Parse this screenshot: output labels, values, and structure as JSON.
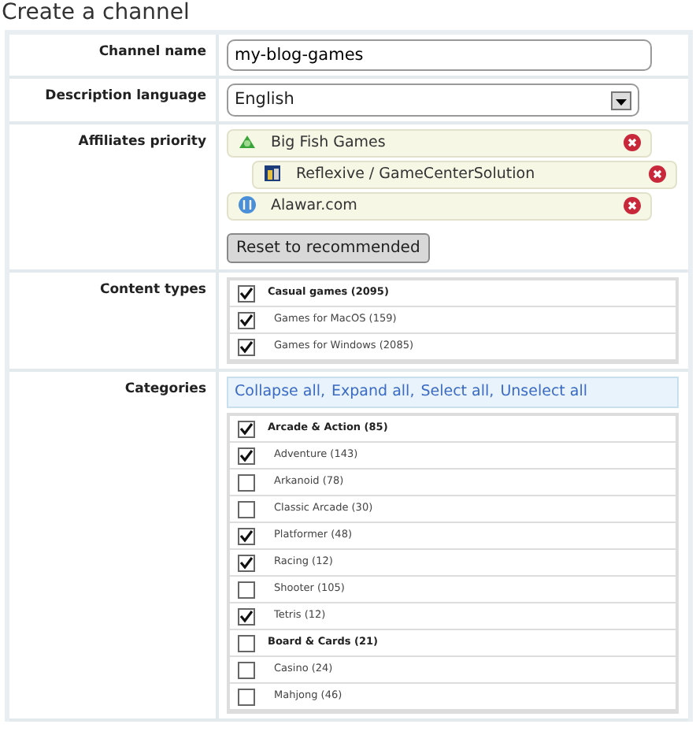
{
  "title": "Create a channel",
  "fields": {
    "channel_name": {
      "label": "Channel name",
      "value": "my-blog-games"
    },
    "language": {
      "label": "Description language",
      "value": "English"
    }
  },
  "affiliates": {
    "label": "Affiliates priority",
    "items": [
      {
        "name": "Big Fish Games",
        "children": [
          {
            "name": "Reflexive / GameCenterSolution"
          }
        ]
      },
      {
        "name": "Alawar.com"
      }
    ],
    "reset_button": "Reset to recommended"
  },
  "content_types": {
    "label": "Content types",
    "items": [
      {
        "name": "Casual games (2095)",
        "checked": true,
        "children": [
          {
            "name": "Games for MacOS (159)",
            "checked": true
          },
          {
            "name": "Games for Windows (2085)",
            "checked": true
          }
        ]
      }
    ]
  },
  "categories": {
    "label": "Categories",
    "link_separator": ",",
    "links": [
      "Collapse all",
      "Expand all",
      "Select all",
      "Unselect all"
    ],
    "items": [
      {
        "name": "Arcade & Action (85)",
        "checked": true,
        "children": [
          {
            "name": "Adventure (143)",
            "checked": true
          },
          {
            "name": "Arkanoid (78)",
            "checked": false
          },
          {
            "name": "Classic Arcade (30)",
            "checked": false
          },
          {
            "name": "Platformer (48)",
            "checked": true
          },
          {
            "name": "Racing (12)",
            "checked": true
          },
          {
            "name": "Shooter (105)",
            "checked": false
          },
          {
            "name": "Tetris (12)",
            "checked": true
          }
        ]
      },
      {
        "name": "Board & Cards (21)",
        "checked": false,
        "children": [
          {
            "name": "Casino (24)",
            "checked": false
          },
          {
            "name": "Mahjong (46)",
            "checked": false
          }
        ]
      }
    ]
  }
}
